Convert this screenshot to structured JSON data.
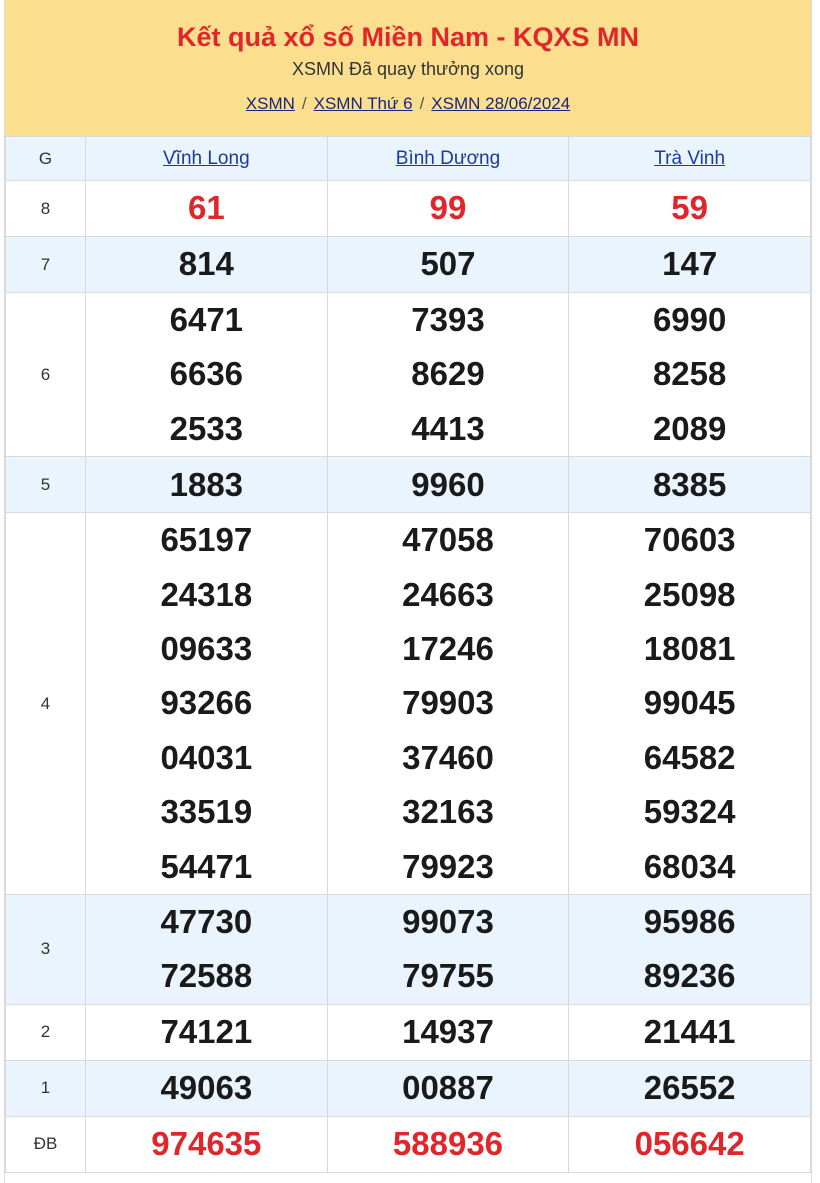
{
  "header": {
    "title": "Kết quả xổ số Miền Nam - KQXS MN",
    "subtitle": "XSMN Đã quay thưởng xong",
    "breadcrumbs": [
      "XSMN",
      "XSMN Thứ 6",
      "XSMN 28/06/2024"
    ],
    "separator": "/"
  },
  "table": {
    "corner_label": "G",
    "provinces": [
      "Vĩnh Long",
      "Bình Dương",
      "Trà Vinh"
    ],
    "prizes": [
      {
        "label": "8",
        "values": [
          [
            "61"
          ],
          [
            "99"
          ],
          [
            "59"
          ]
        ]
      },
      {
        "label": "7",
        "values": [
          [
            "814"
          ],
          [
            "507"
          ],
          [
            "147"
          ]
        ]
      },
      {
        "label": "6",
        "values": [
          [
            "6471",
            "6636",
            "2533"
          ],
          [
            "7393",
            "8629",
            "4413"
          ],
          [
            "6990",
            "8258",
            "2089"
          ]
        ]
      },
      {
        "label": "5",
        "values": [
          [
            "1883"
          ],
          [
            "9960"
          ],
          [
            "8385"
          ]
        ]
      },
      {
        "label": "4",
        "values": [
          [
            "65197",
            "24318",
            "09633",
            "93266",
            "04031",
            "33519",
            "54471"
          ],
          [
            "47058",
            "24663",
            "17246",
            "79903",
            "37460",
            "32163",
            "79923"
          ],
          [
            "70603",
            "25098",
            "18081",
            "99045",
            "64582",
            "59324",
            "68034"
          ]
        ]
      },
      {
        "label": "3",
        "values": [
          [
            "47730",
            "72588"
          ],
          [
            "99073",
            "79755"
          ],
          [
            "95986",
            "89236"
          ]
        ]
      },
      {
        "label": "2",
        "values": [
          [
            "74121"
          ],
          [
            "14937"
          ],
          [
            "21441"
          ]
        ]
      },
      {
        "label": "1",
        "values": [
          [
            "49063"
          ],
          [
            "00887"
          ],
          [
            "26552"
          ]
        ]
      },
      {
        "label": "ĐB",
        "values": [
          [
            "974635"
          ],
          [
            "588936"
          ],
          [
            "056642"
          ]
        ]
      }
    ]
  },
  "colors": {
    "header_bg": "#fcdf8e",
    "title_red": "#e0262b",
    "alt_row_bg": "#eaf4fe",
    "link_blue": "#1a237e"
  }
}
